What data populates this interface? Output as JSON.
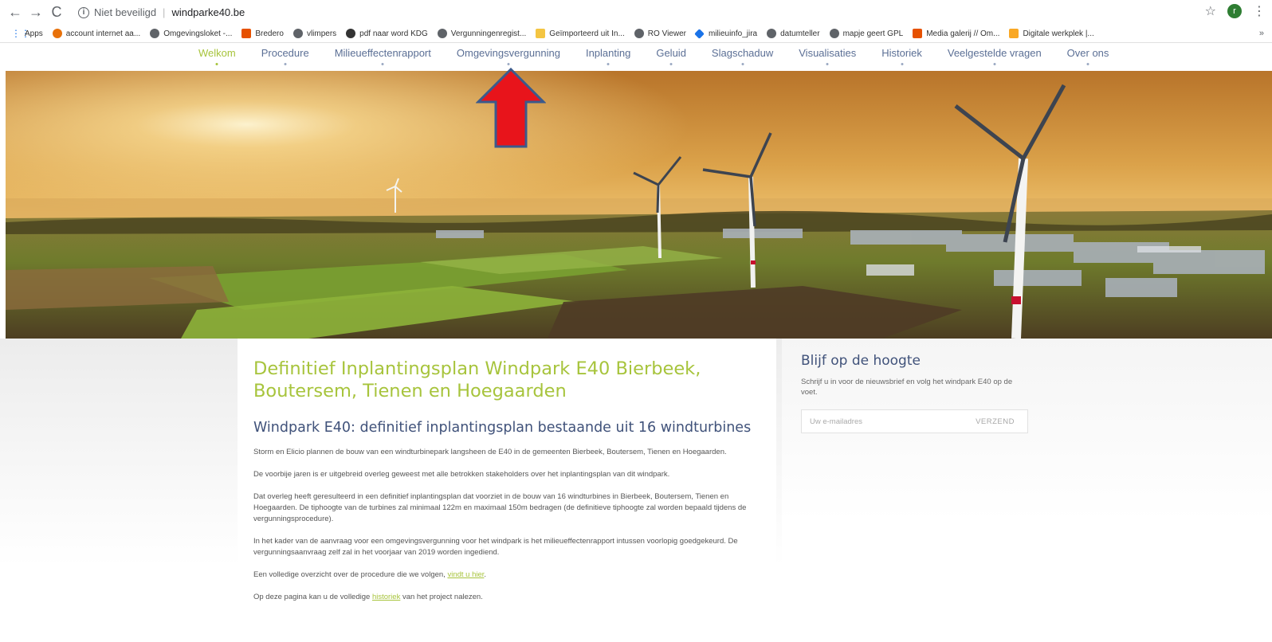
{
  "browser": {
    "back": "←",
    "forward": "→",
    "reload": "C",
    "security_label": "Niet beveiligd",
    "separator": "|",
    "url": "windparke40.be",
    "bookmarks": [
      {
        "label": "Apps",
        "icon": "apps-icon"
      },
      {
        "label": "account internet aa...",
        "icon": "orange-icon"
      },
      {
        "label": "Omgevingsloket -...",
        "icon": "globe-icon"
      },
      {
        "label": "Bredero",
        "icon": "bredero-icon"
      },
      {
        "label": "vlimpers",
        "icon": "globe-icon"
      },
      {
        "label": "pdf naar word KDG",
        "icon": "dot-icon"
      },
      {
        "label": "Vergunningenregist...",
        "icon": "globe-icon"
      },
      {
        "label": "Geïmporteerd uit In...",
        "icon": "folder-icon"
      },
      {
        "label": "RO Viewer",
        "icon": "globe-icon"
      },
      {
        "label": "milieuinfo_jira",
        "icon": "diamond-icon"
      },
      {
        "label": "datumteller",
        "icon": "globe-icon"
      },
      {
        "label": "mapje geert GPL",
        "icon": "globe-icon"
      },
      {
        "label": "Media galerij // Om...",
        "icon": "media-icon"
      },
      {
        "label": "Digitale werkplek |...",
        "icon": "lightning-icon"
      }
    ],
    "more": "»"
  },
  "nav": {
    "items": [
      {
        "label": "Welkom",
        "active": true
      },
      {
        "label": "Procedure",
        "active": false
      },
      {
        "label": "Milieueffectenrapport",
        "active": false
      },
      {
        "label": "Omgevingsvergunning",
        "active": false
      },
      {
        "label": "Inplanting",
        "active": false
      },
      {
        "label": "Geluid",
        "active": false
      },
      {
        "label": "Slagschaduw",
        "active": false
      },
      {
        "label": "Visualisaties",
        "active": false
      },
      {
        "label": "Historiek",
        "active": false
      },
      {
        "label": "Veelgestelde vragen",
        "active": false
      },
      {
        "label": "Over ons",
        "active": false
      }
    ]
  },
  "colors": {
    "accent_green": "#a7c43c",
    "nav_blue": "#5b6f95",
    "heading_blue": "#40527a",
    "arrow_red": "#e8141b",
    "arrow_border": "#3b5a8c"
  },
  "main": {
    "title": "Definitief Inplantingsplan Windpark E40 Bierbeek, Boutersem, Tienen en Hoegaarden",
    "subtitle": "Windpark E40: definitief inplantingsplan bestaande uit 16 windturbines",
    "p1": "Storm en Elicio plannen de bouw van een windturbinepark langsheen de E40 in de gemeenten Bierbeek, Boutersem, Tienen en Hoegaarden.",
    "p2": "De voorbije jaren is er uitgebreid overleg geweest met alle betrokken stakeholders over het inplantingsplan van dit windpark.",
    "p3": "Dat overleg heeft geresulteerd in een definitief inplantingsplan dat voorziet in de bouw van 16 windturbines in Bierbeek, Boutersem, Tienen en Hoegaarden. De tiphoogte van de turbines zal minimaal 122m en maximaal 150m bedragen (de definitieve tiphoogte zal worden bepaald tijdens de vergunningsprocedure).",
    "p4": "In het kader van de aanvraag voor een omgevingsvergunning voor het windpark is het milieueffectenrapport intussen voorlopig goedgekeurd. De vergunningsaanvraag zelf zal in het voorjaar van 2019 worden ingediend.",
    "p5_before": "Een volledige overzicht over de procedure die we volgen, ",
    "p5_link": "vindt u hier",
    "p5_after": ".",
    "p6_before": "Op deze pagina kan u de volledige ",
    "p6_link": "historiek",
    "p6_after": " van het project nalezen."
  },
  "sidebar": {
    "title": "Blijf op de hoogte",
    "text": "Schrijf u in voor de nieuwsbrief en volg het windpark E40 op de voet.",
    "email_placeholder": "Uw e-mailadres",
    "submit": "VERZEND"
  }
}
